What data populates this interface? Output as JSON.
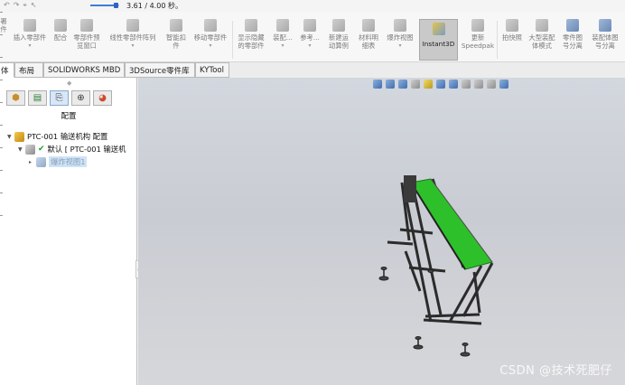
{
  "quick_access": {
    "icons": [
      "undo-icon",
      "redo-icon",
      "select-icon",
      "pointer-icon"
    ]
  },
  "zoom_slider": {
    "value": 3.61,
    "max": 4.0,
    "fraction": 0.9025,
    "readout": "3.61 / 4.00 秒。"
  },
  "ribbon": {
    "items": [
      {
        "id": "insert-component",
        "label": "插入零部件",
        "dropdown": true
      },
      {
        "id": "mate",
        "label": "配合",
        "dropdown": false
      },
      {
        "id": "component-preview",
        "label": "零部件预\n览窗口",
        "dropdown": false
      },
      {
        "id": "linear-pattern",
        "label": "线性零部件阵列",
        "dropdown": true
      },
      {
        "id": "smart-fasteners",
        "label": "智能扣\n件",
        "dropdown": false
      },
      {
        "id": "move-component",
        "label": "移动零部件",
        "dropdown": true
      },
      {
        "id": "show-hidden",
        "label": "显示隐藏\n的零部件",
        "dropdown": false
      },
      {
        "id": "assembly-features",
        "label": "装配...",
        "dropdown": true
      },
      {
        "id": "reference",
        "label": "参考...",
        "dropdown": true
      },
      {
        "id": "new-motion-study",
        "label": "新建运\n动算例",
        "dropdown": false
      },
      {
        "id": "bom",
        "label": "材料明\n细表",
        "dropdown": false
      },
      {
        "id": "exploded-view",
        "label": "爆炸视图",
        "dropdown": true
      },
      {
        "id": "update-speedpak",
        "label": "更新\nSpeedpak",
        "dropdown": false
      },
      {
        "id": "snapshot",
        "label": "拍快照",
        "dropdown": false
      },
      {
        "id": "large-assembly",
        "label": "大型装配\n体模式",
        "dropdown": false
      },
      {
        "id": "part-number-separate",
        "label": "零件图\n号分离",
        "dropdown": false
      },
      {
        "id": "assembly-number-separate",
        "label": "装配体图\n号分离",
        "dropdown": false
      }
    ],
    "instant3d": "Instant3D",
    "left_clip": "署\n件"
  },
  "tabs": [
    "体",
    "布局",
    "SOLIDWORKS MBD",
    "3DSource零件库",
    "KYTool"
  ],
  "active_tab": 0,
  "panel": {
    "tabs": [
      "feature-manager-icon",
      "property-manager-icon",
      "configuration-manager-icon",
      "dimxpert-icon",
      "display-manager-icon"
    ],
    "active_panel_tab": 2,
    "title": "配置",
    "tree": {
      "root": "PTC-001 输送机构 配置",
      "config": "默认 [ PTC-001 输送机",
      "child": "爆炸视图1"
    }
  },
  "viewport": {
    "toolbar_icons": [
      "zoom-to-fit-icon",
      "zoom-area-icon",
      "previous-view-icon",
      "section-view-icon",
      "dynamic-annotation-icon",
      "view-orientation-icon",
      "display-style-icon",
      "hide-show-icon",
      "edit-appearance-icon",
      "apply-scene-icon",
      "view-settings-icon"
    ],
    "watermark": "CSDN @技术死肥仔",
    "model_colors": {
      "belt": "#2ec02a",
      "frame": "#2b2b2b"
    }
  }
}
